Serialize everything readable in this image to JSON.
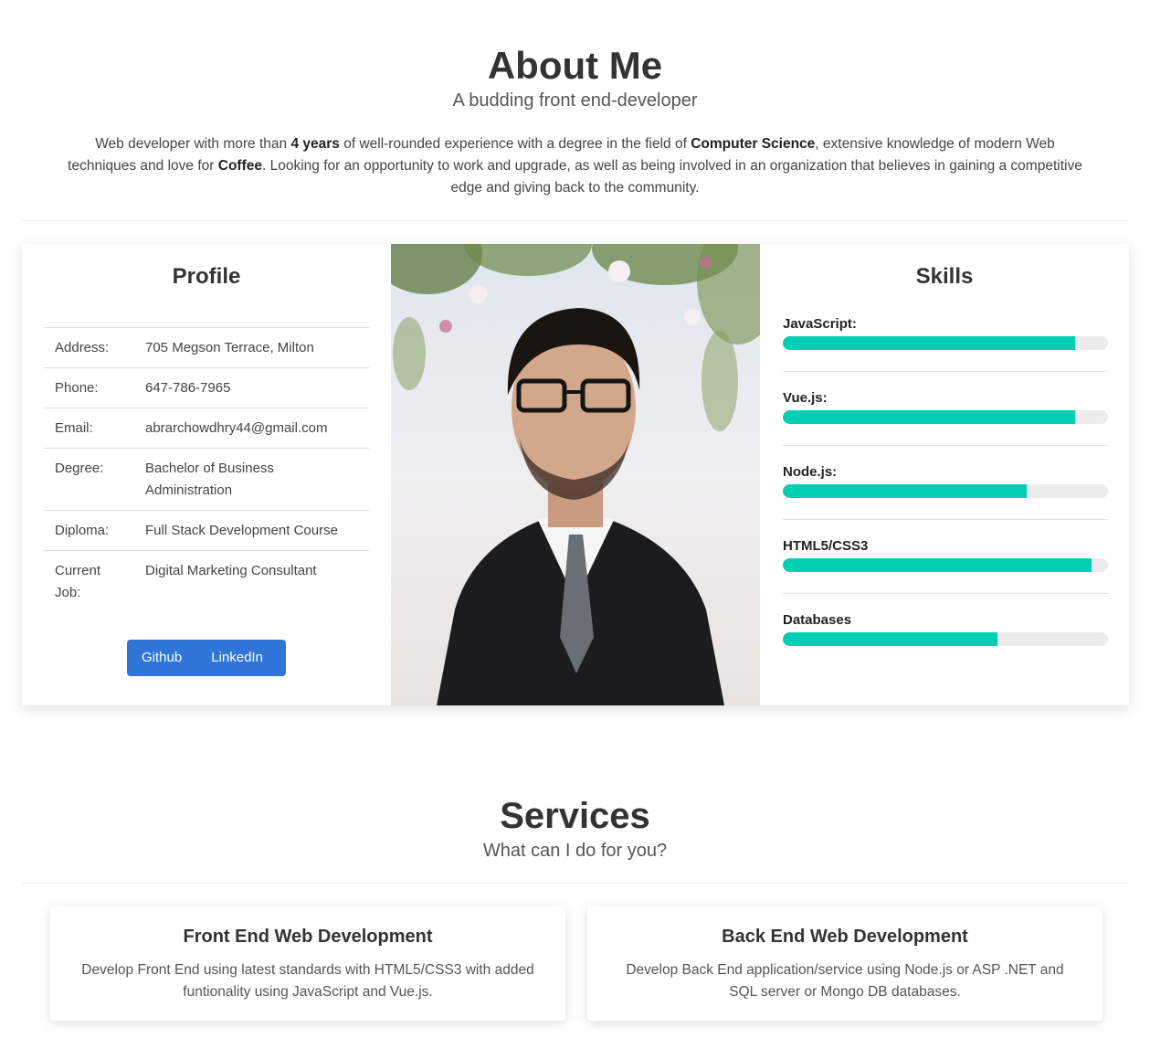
{
  "about": {
    "title": "About Me",
    "subtitle": "A budding front end-developer",
    "intro": {
      "p1": "Web developer with more than ",
      "b1": "4 years",
      "p2": " of well-rounded experience with a degree in the field of ",
      "b2": "Computer Science",
      "p3": ", extensive knowledge of modern Web techniques and love for ",
      "b3": "Coffee",
      "p4": ". Looking for an opportunity to work and upgrade, as well as being involved in an organization that believes in gaining a competitive edge and giving back to the community."
    }
  },
  "profile": {
    "heading": "Profile",
    "rows": [
      {
        "label": "Address:",
        "value": "705 Megson Terrace, Milton"
      },
      {
        "label": "Phone:",
        "value": "647-786-7965"
      },
      {
        "label": "Email:",
        "value": "abrarchowdhry44@gmail.com"
      },
      {
        "label": "Degree:",
        "value": "Bachelor of Business Administration"
      },
      {
        "label": "Diploma:",
        "value": "Full Stack Development Course"
      },
      {
        "label": "Current Job:",
        "value": "Digital Marketing Consultant"
      }
    ],
    "buttons": {
      "github": "Github",
      "linkedin": "LinkedIn"
    }
  },
  "skills": {
    "heading": "Skills",
    "items": [
      {
        "label": "JavaScript:",
        "level": 0.9
      },
      {
        "label": "Vue.js:",
        "level": 0.9
      },
      {
        "label": "Node.js:",
        "level": 0.75
      },
      {
        "label": "HTML5/CSS3",
        "level": 0.95
      },
      {
        "label": "Databases",
        "level": 0.66
      }
    ],
    "fill_color": "#00cfb4"
  },
  "services": {
    "title": "Services",
    "subtitle": "What can I do for you?",
    "cards": [
      {
        "title": "Front End Web Development",
        "desc": "Develop Front End using latest standards with HTML5/CSS3 with added funtionality using JavaScript and Vue.js."
      },
      {
        "title": "Back End Web Development",
        "desc": "Develop Back End application/service using Node.js or ASP .NET and SQL server or Mongo DB databases."
      }
    ]
  },
  "colors": {
    "button": "#2f76d8",
    "skill_bar": "#00cfb4"
  }
}
